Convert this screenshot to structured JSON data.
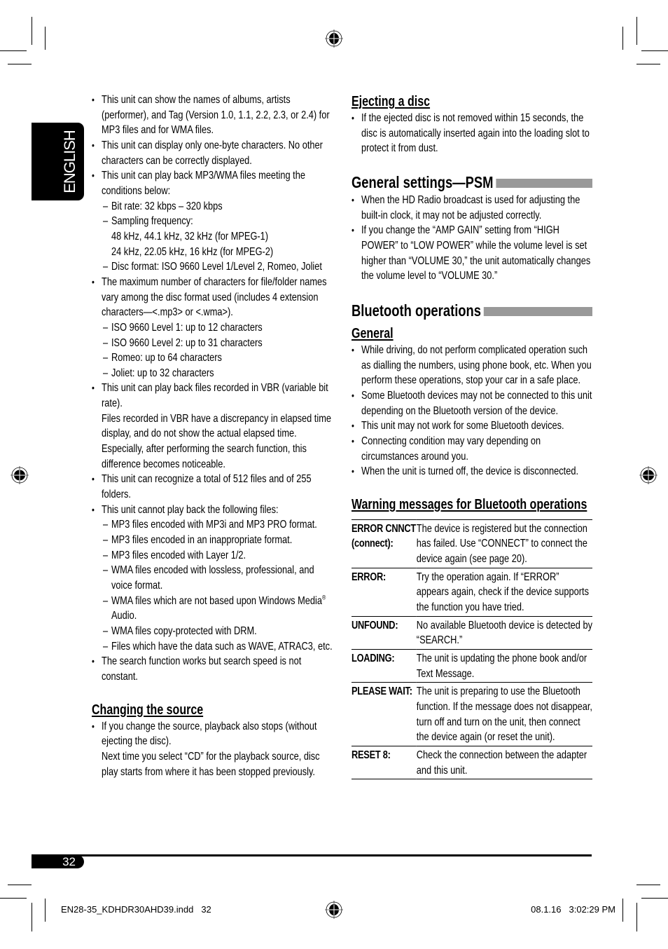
{
  "language_tab": "ENGLISH",
  "page_number": "32",
  "theme": {
    "heading_bar": "#999999",
    "tab_background": "#000000"
  },
  "left": {
    "bullets": [
      {
        "text": "This unit can show the names of albums, artists (performer), and Tag (Version 1.0, 1.1, 2.2, 2.3, or 2.4) for MP3 files and for WMA files."
      },
      {
        "text": "This unit can display only one-byte characters. No other characters can be correctly displayed."
      },
      {
        "text": "This unit can play back MP3/WMA files meeting the conditions below:",
        "sub": [
          {
            "text": "Bit rate: 32 kbps – 320 kbps"
          },
          {
            "text": "Sampling frequency:",
            "lines": [
              "48 kHz, 44.1 kHz, 32 kHz (for MPEG-1)",
              "24 kHz, 22.05 kHz, 16 kHz (for MPEG-2)"
            ]
          },
          {
            "text": "Disc format: ISO 9660 Level 1/Level 2, Romeo, Joliet"
          }
        ]
      },
      {
        "text": "The maximum number of characters for file/folder names vary among the disc format used (includes 4 extension characters—<.mp3> or <.wma>).",
        "sub": [
          {
            "text": "ISO 9660 Level 1: up to 12 characters"
          },
          {
            "text": "ISO 9660 Level 2: up to 31 characters"
          },
          {
            "text": "Romeo: up to 64 characters"
          },
          {
            "text": "Joliet: up to 32 characters"
          }
        ]
      },
      {
        "text": "This unit can play back files recorded in VBR (variable bit rate).",
        "note": "Files recorded in VBR have a discrepancy in elapsed time display, and do not show the actual elapsed time. Especially, after performing the search function, this difference becomes noticeable."
      },
      {
        "text": "This unit can recognize a total of 512 files and of 255 folders."
      },
      {
        "text": "This unit cannot play back the following files:",
        "sub": [
          {
            "text": "MP3 files encoded with MP3i and MP3 PRO format."
          },
          {
            "text": "MP3 files encoded in an inappropriate format."
          },
          {
            "text": "MP3 files encoded with Layer 1/2."
          },
          {
            "text": "WMA files encoded with lossless, professional, and voice format."
          },
          {
            "text": "WMA files which are not based upon Windows Media",
            "sup": "®",
            "tail": " Audio."
          },
          {
            "text": "WMA files copy-protected with DRM."
          },
          {
            "text": "Files which have the data such as WAVE, ATRAC3, etc."
          }
        ]
      },
      {
        "text": "The search function works but search speed is not constant."
      }
    ],
    "changing_source": {
      "heading": "Changing the source",
      "bullets": [
        {
          "text": "If you change the source, playback also stops (without ejecting the disc).",
          "note": "Next time you select “CD” for the playback source, disc play starts from where it has been stopped previously."
        }
      ]
    }
  },
  "right": {
    "ejecting": {
      "heading": "Ejecting a disc",
      "bullets": [
        {
          "text": "If the ejected disc is not removed within 15 seconds, the disc is automatically inserted again into the loading slot to protect it from dust."
        }
      ]
    },
    "psm": {
      "heading": "General settings—PSM",
      "bullets": [
        {
          "text": "When the HD Radio broadcast is used for adjusting the built-in clock, it may not be adjusted correctly."
        },
        {
          "text": "If you change the “AMP GAIN” setting from “HIGH POWER” to “LOW POWER” while the volume level is set higher than “VOLUME 30,” the unit automatically changes the volume level to “VOLUME 30.”"
        }
      ]
    },
    "bluetooth": {
      "heading": "Bluetooth operations",
      "general": {
        "heading": "General",
        "bullets": [
          {
            "text": "While driving, do not perform complicated operation such as dialling the numbers, using phone book, etc. When you perform these operations, stop your car in a safe place."
          },
          {
            "text": "Some Bluetooth devices may not be connected to this unit depending on the Bluetooth version of the device."
          },
          {
            "text": "This unit may not work for some Bluetooth devices."
          },
          {
            "text": "Connecting condition may vary depending on circumstances around you."
          },
          {
            "text": "When the unit is turned off, the device is disconnected."
          }
        ]
      },
      "warnings": {
        "heading": "Warning messages for Bluetooth operations",
        "rows": [
          {
            "label": "ERROR CNNCT (connect):",
            "description": "The device is registered but the connection has failed. Use “CONNECT” to connect the device again (see page 20)."
          },
          {
            "label": "ERROR:",
            "description": "Try the operation again. If “ERROR” appears again, check if the device supports the function you have tried."
          },
          {
            "label": "UNFOUND:",
            "description": "No available Bluetooth device is detected by “SEARCH.”"
          },
          {
            "label": "LOADING:",
            "description": "The unit is updating the phone book and/or Text Message."
          },
          {
            "label": "PLEASE WAIT:",
            "description": "The unit is preparing to use the Bluetooth function. If the message does not disappear, turn off and turn on the unit, then connect the device again (or reset the unit)."
          },
          {
            "label": "RESET 8:",
            "description": "Check the connection between the adapter and this unit."
          }
        ]
      }
    }
  },
  "footer": {
    "file": "EN28-35_KDHDR30AHD39.indd",
    "page": "32",
    "date": "08.1.16",
    "time": "3:02:29 PM"
  }
}
